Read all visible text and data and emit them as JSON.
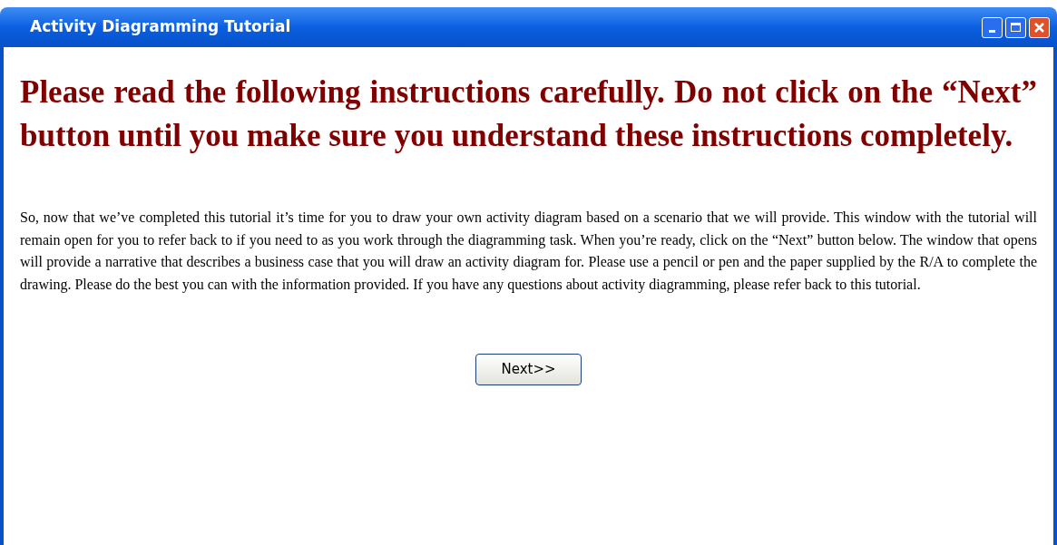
{
  "window": {
    "title": "Activity Diagramming Tutorial"
  },
  "heading": "Please read the following instructions carefully.  Do not click on the “Next” button until you make sure you understand these instructions completely.",
  "body": "So, now that we’ve completed this tutorial it’s time for you to draw your own activity diagram based on a scenario that we will provide.  This window with the tutorial will remain open for you to refer back to if you need to as you work through the diagramming task.  When you’re ready, click on the “Next” button below.  The window that opens will provide a narrative that describes a business case that you will draw an activity diagram for.  Please use a pencil or pen and the paper supplied by the R/A to complete the drawing.  Please do the best you can with the information provided.  If you have any questions about activity diagramming, please refer back to this tutorial.",
  "button": "Next>>"
}
